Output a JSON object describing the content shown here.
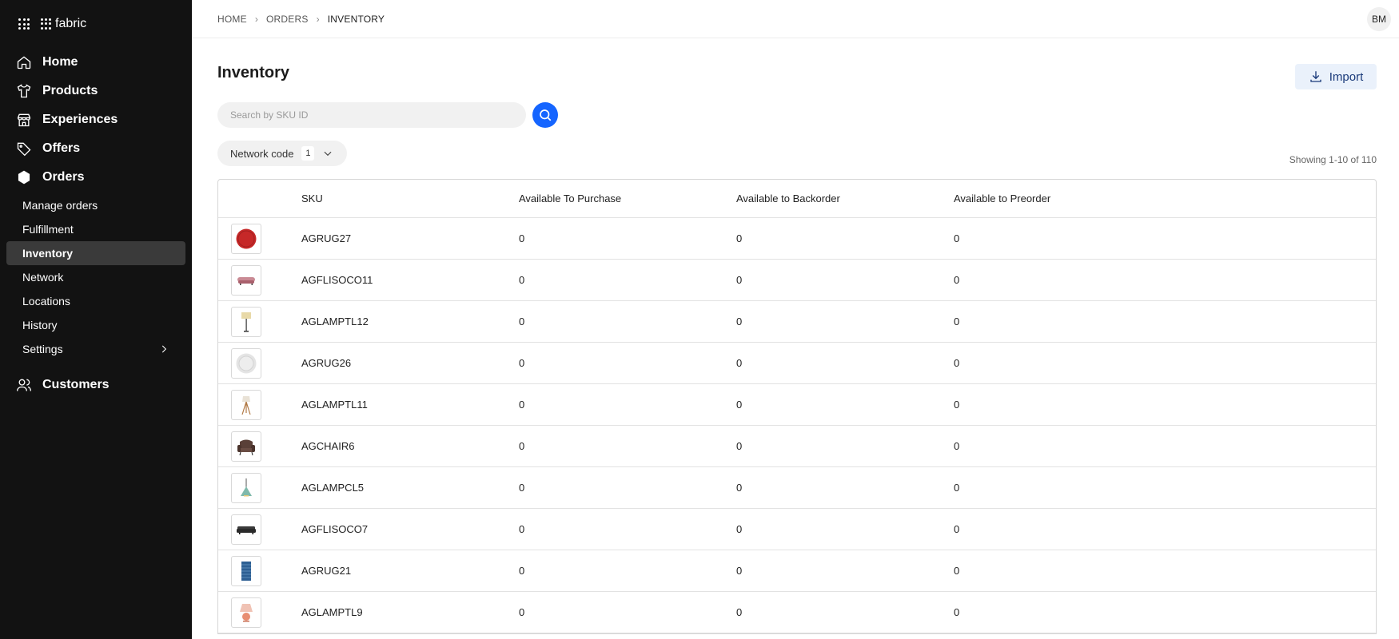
{
  "brand": {
    "name": "fabric"
  },
  "sidebar": {
    "main_items": [
      {
        "label": "Home",
        "icon": "home-icon"
      },
      {
        "label": "Products",
        "icon": "shirt-icon"
      },
      {
        "label": "Experiences",
        "icon": "store-icon"
      },
      {
        "label": "Offers",
        "icon": "tag-icon"
      },
      {
        "label": "Orders",
        "icon": "hexagon-icon"
      }
    ],
    "order_sub_items": [
      {
        "label": "Manage orders"
      },
      {
        "label": "Fulfillment"
      },
      {
        "label": "Inventory",
        "active": true
      },
      {
        "label": "Network"
      },
      {
        "label": "Locations"
      },
      {
        "label": "History"
      },
      {
        "label": "Settings",
        "has_chevron": true
      }
    ],
    "customers": {
      "label": "Customers",
      "icon": "users-icon"
    }
  },
  "breadcrumb": [
    "HOME",
    "ORDERS",
    "INVENTORY"
  ],
  "user": {
    "initials": "BM"
  },
  "page": {
    "title": "Inventory",
    "import_label": "Import",
    "search_placeholder": "Search by SKU ID",
    "filter": {
      "label": "Network code",
      "count": "1"
    },
    "showing": "Showing 1-10 of 110"
  },
  "table": {
    "columns": [
      "SKU",
      "Available To Purchase",
      "Available to Backorder",
      "Available to Preorder"
    ],
    "rows": [
      {
        "sku": "AGRUG27",
        "purchase": "0",
        "backorder": "0",
        "preorder": "0",
        "thumb": "red-round-rug"
      },
      {
        "sku": "AGFLISOCO11",
        "purchase": "0",
        "backorder": "0",
        "preorder": "0",
        "thumb": "pink-sofa"
      },
      {
        "sku": "AGLAMPTL12",
        "purchase": "0",
        "backorder": "0",
        "preorder": "0",
        "thumb": "floor-lamp"
      },
      {
        "sku": "AGRUG26",
        "purchase": "0",
        "backorder": "0",
        "preorder": "0",
        "thumb": "white-round-rug"
      },
      {
        "sku": "AGLAMPTL11",
        "purchase": "0",
        "backorder": "0",
        "preorder": "0",
        "thumb": "tripod-lamp"
      },
      {
        "sku": "AGCHAIR6",
        "purchase": "0",
        "backorder": "0",
        "preorder": "0",
        "thumb": "brown-armchair"
      },
      {
        "sku": "AGLAMPCL5",
        "purchase": "0",
        "backorder": "0",
        "preorder": "0",
        "thumb": "pendant-lamp"
      },
      {
        "sku": "AGFLISOCO7",
        "purchase": "0",
        "backorder": "0",
        "preorder": "0",
        "thumb": "dark-sofa"
      },
      {
        "sku": "AGRUG21",
        "purchase": "0",
        "backorder": "0",
        "preorder": "0",
        "thumb": "blue-rug"
      },
      {
        "sku": "AGLAMPTL9",
        "purchase": "0",
        "backorder": "0",
        "preorder": "0",
        "thumb": "table-lamp"
      }
    ]
  },
  "colors": {
    "sidebar_bg": "#121212",
    "accent": "#1565ff",
    "import_bg": "#eaf1fb"
  }
}
